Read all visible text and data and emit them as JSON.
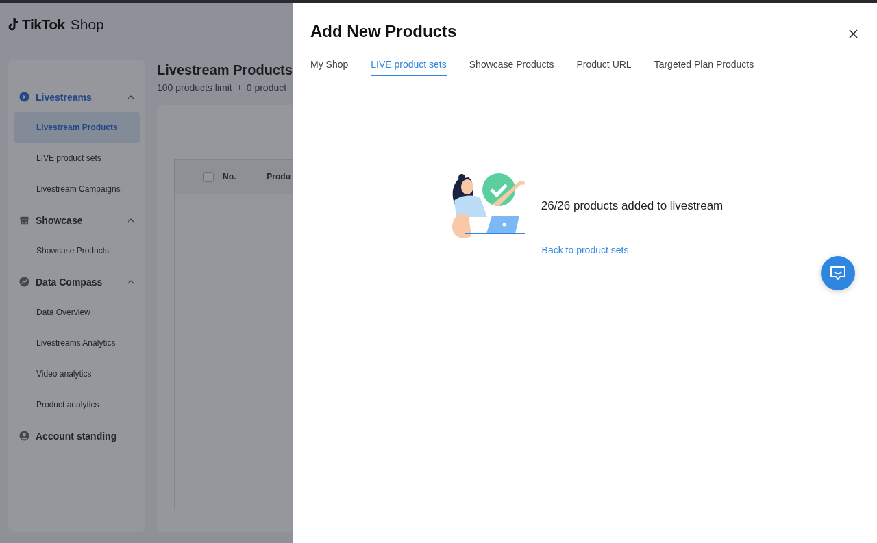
{
  "logo": {
    "brand": "TikTok",
    "suffix": "Shop"
  },
  "sidebar": {
    "groups": [
      {
        "label": "Livestreams",
        "kind": "play",
        "selected": true,
        "expanded": true,
        "children": [
          {
            "label": "Livestream Products",
            "selected": true
          },
          {
            "label": "LIVE product sets",
            "selected": false
          },
          {
            "label": "Livestream Campaigns",
            "selected": false
          }
        ]
      },
      {
        "label": "Showcase",
        "kind": "store",
        "selected": false,
        "expanded": true,
        "children": [
          {
            "label": "Showcase Products",
            "selected": false
          }
        ]
      },
      {
        "label": "Data Compass",
        "kind": "compass",
        "selected": false,
        "expanded": true,
        "children": [
          {
            "label": "Data Overview",
            "selected": false
          },
          {
            "label": "Livestreams Analytics",
            "selected": false
          },
          {
            "label": "Video analytics",
            "selected": false
          },
          {
            "label": "Product analytics",
            "selected": false
          }
        ]
      },
      {
        "label": "Account standing",
        "kind": "person",
        "selected": false
      }
    ]
  },
  "main": {
    "title": "Livestream Products",
    "limit": "100 products limit",
    "count": "0 product",
    "table": {
      "select_all": {
        "checked": false
      },
      "columns": [
        "No.",
        "Produ"
      ]
    }
  },
  "drawer": {
    "title": "Add New Products",
    "tabs": [
      {
        "label": "My Shop",
        "selected": false
      },
      {
        "label": "LIVE product sets",
        "selected": true
      },
      {
        "label": "Showcase Products",
        "selected": false
      },
      {
        "label": "Product URL",
        "selected": false
      },
      {
        "label": "Targeted Plan Products",
        "selected": false
      }
    ],
    "message": "26/26 products added to livestream",
    "link": "Back to product sets"
  }
}
